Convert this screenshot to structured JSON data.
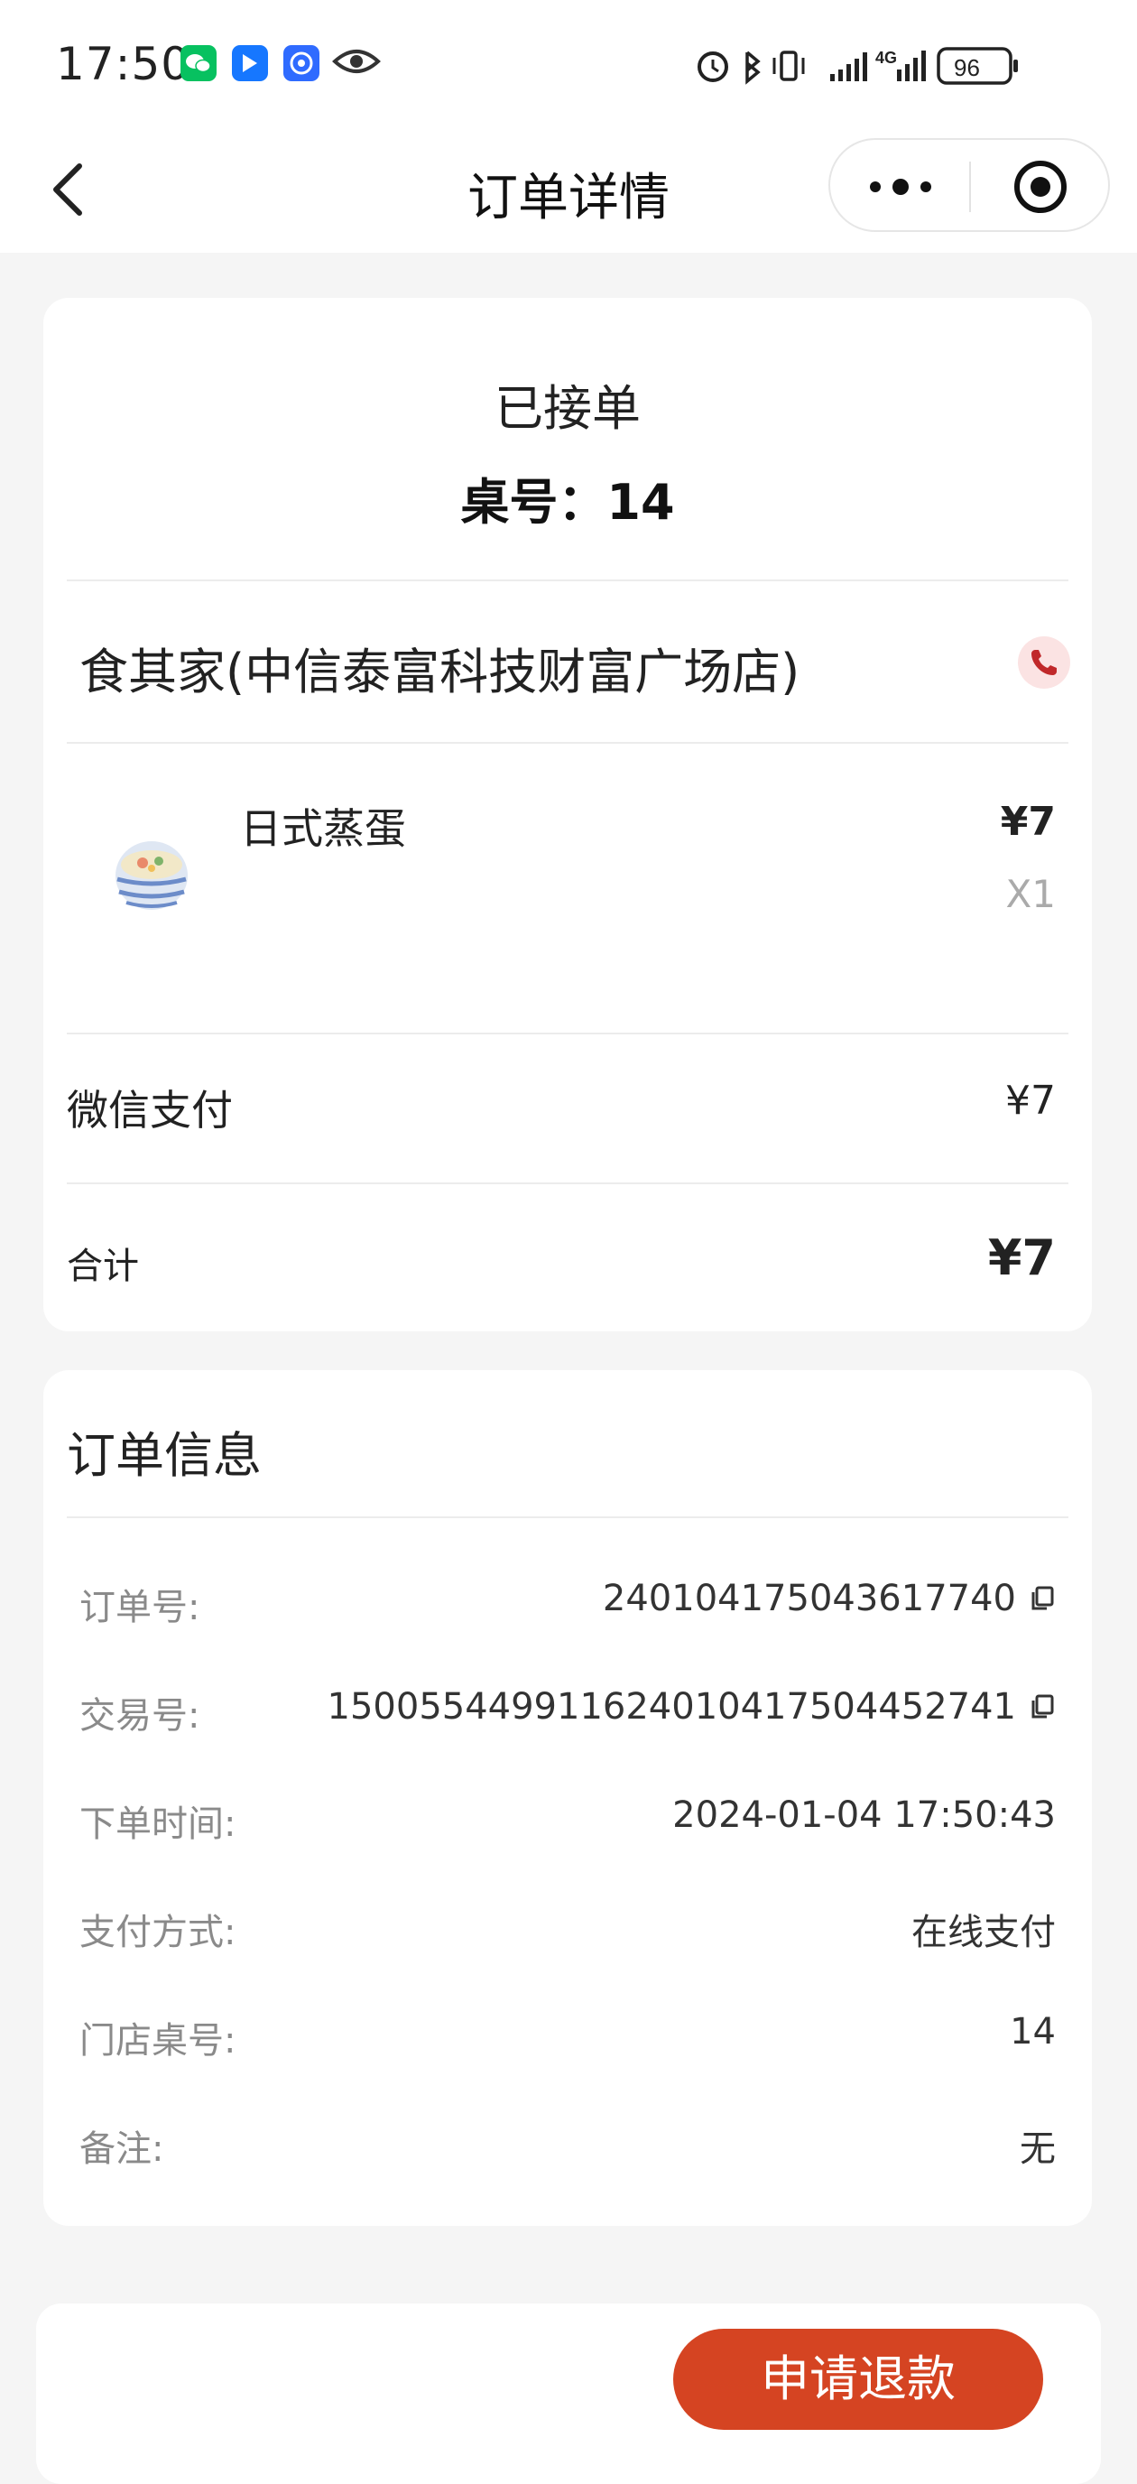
{
  "status_bar": {
    "time": "17:50",
    "network": "4G",
    "battery": "96"
  },
  "nav": {
    "title": "订单详情"
  },
  "order": {
    "status": "已接单",
    "table_label": "桌号：14",
    "store_name": "食其家(中信泰富科技财富广场店)",
    "item": {
      "name": "日式蒸蛋",
      "price": "¥7",
      "quantity": "X1"
    },
    "payment": {
      "label": "微信支付",
      "value": "¥7"
    },
    "total": {
      "label": "合计",
      "value": "¥7"
    }
  },
  "info": {
    "title": "订单信息",
    "rows": [
      {
        "label": "订单号:",
        "value": "240104175043617740"
      },
      {
        "label": "交易号:",
        "value": "1500554499116240104175044527 41"
      },
      {
        "label": "下单时间:",
        "value": "2024-01-04 17:50:43"
      },
      {
        "label": "支付方式:",
        "value": "在线支付"
      },
      {
        "label": "门店桌号:",
        "value": "14"
      },
      {
        "label": "备注:",
        "value": "无"
      }
    ]
  },
  "actions": {
    "refund_label": "申请退款"
  },
  "colors": {
    "accent": "#d54422",
    "phone": "#c0282a",
    "background": "#f5f5f5"
  }
}
